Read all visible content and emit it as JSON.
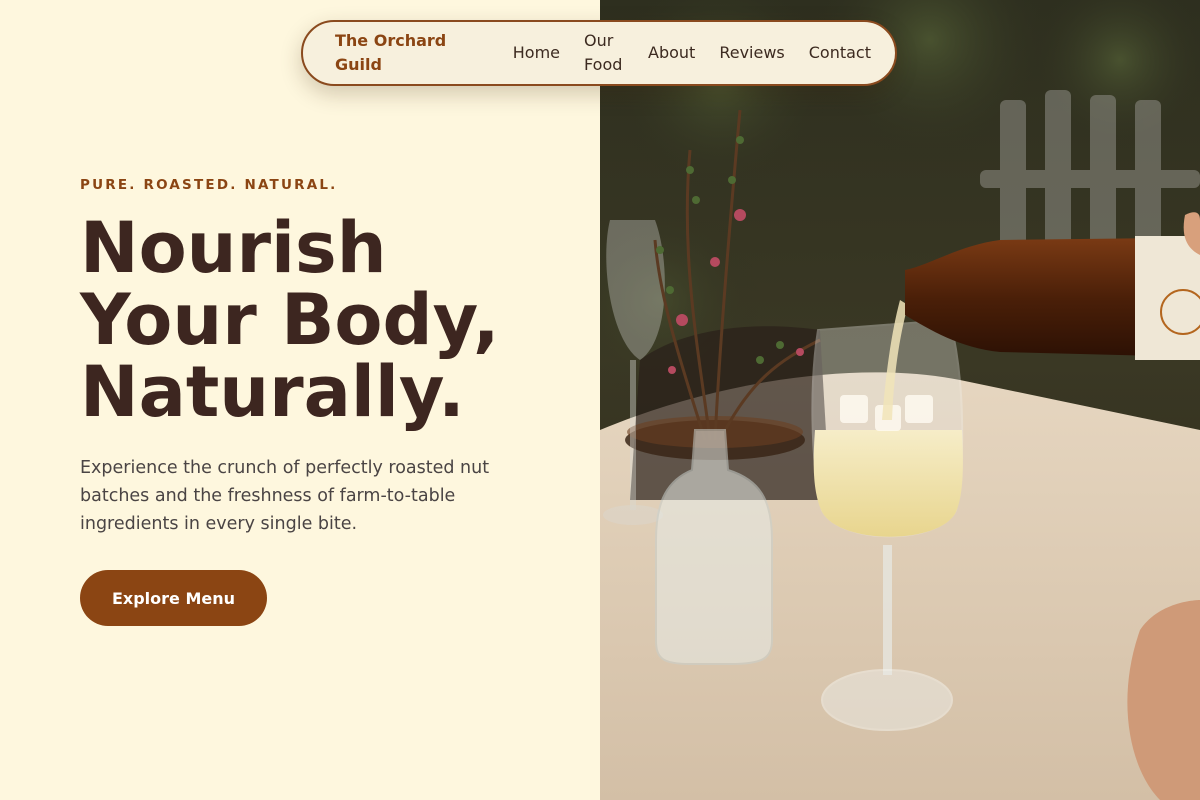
{
  "nav": {
    "brand": "The Orchard Guild",
    "links": [
      "Home",
      "Our Food",
      "About",
      "Reviews",
      "Contact"
    ]
  },
  "hero": {
    "eyebrow": "PURE. ROASTED. NATURAL.",
    "headline_lines": [
      "Nourish",
      "Your Body,",
      "Naturally."
    ],
    "subtitle": "Experience the crunch of perfectly roasted nut batches and the freshness of farm-to-table ingredients in every single bite.",
    "cta_label": "Explore Menu"
  },
  "colors": {
    "background": "#fef7de",
    "accent": "#8b4513",
    "heading": "#3d2620",
    "body_text": "#4a4444"
  },
  "image": {
    "alt": "Pouring a drink from a bottle into a glass on a table beside a small vase of flowers"
  }
}
